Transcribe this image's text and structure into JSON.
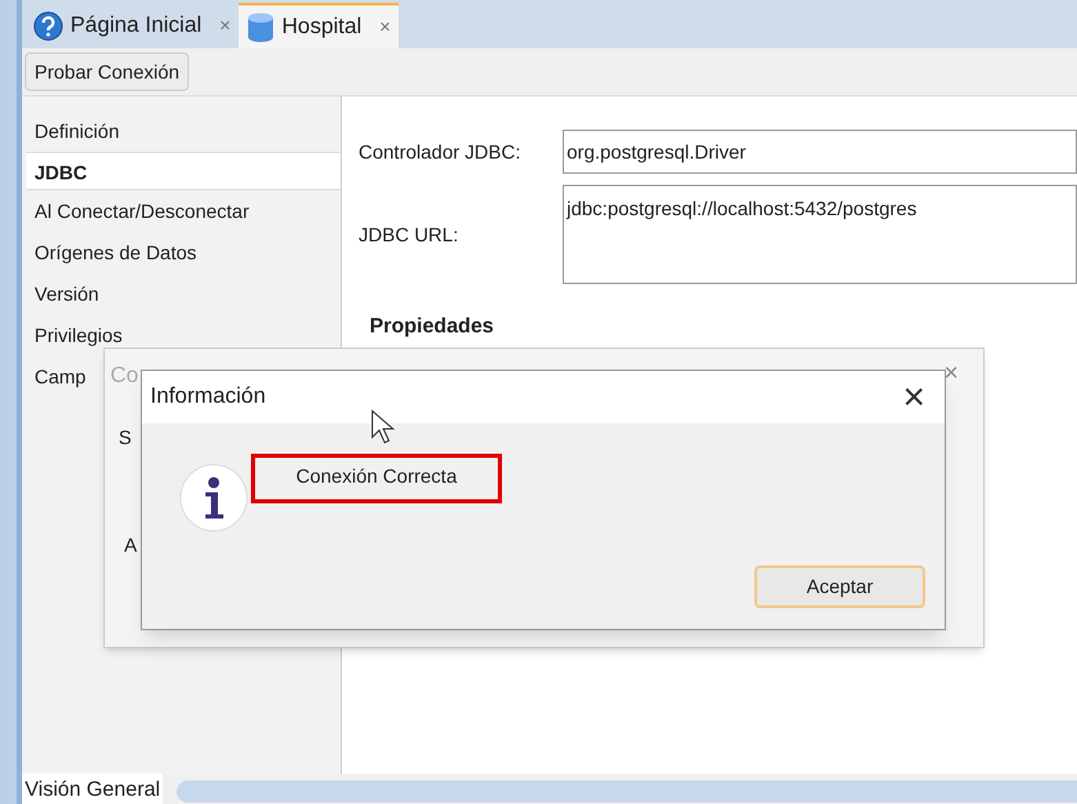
{
  "tabs": [
    {
      "label": "Página Inicial",
      "close": "×",
      "selected": false
    },
    {
      "label": "Hospital",
      "close": "×",
      "selected": true
    }
  ],
  "toolbar": {
    "button": "Probar Conexión"
  },
  "sidebar": {
    "items": [
      {
        "label": "Definición",
        "selected": false
      },
      {
        "label": "JDBC",
        "selected": true
      },
      {
        "label": "Al Conectar/Desconectar",
        "selected": false
      },
      {
        "label": "Orígenes de Datos",
        "selected": false
      },
      {
        "label": "Versión",
        "selected": false
      },
      {
        "label": "Privilegios",
        "selected": false
      },
      {
        "label": "Camp",
        "selected": false
      }
    ]
  },
  "form": {
    "driver_label": "Controlador JDBC:",
    "driver_value": "org.postgresql.Driver",
    "url_label": "JDBC URL:",
    "url_value": "jdbc:postgresql://localhost:5432/postgres",
    "section": "Propiedades"
  },
  "back_dialog": {
    "title": "Co",
    "close": "×",
    "label_1": "S",
    "label_2": "A"
  },
  "info_dialog": {
    "title": "Información",
    "close": "×",
    "message": "Conexión Correcta",
    "highlighted": true,
    "button": "Aceptar"
  },
  "bottom_tab": "Visión General"
}
